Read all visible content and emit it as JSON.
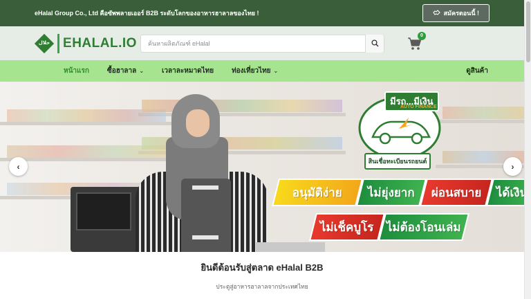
{
  "topbar": {
    "announcement": "eHalal Group Co., Ltd คือซัพพลายเออร์ B2B ระดับโลกของอาหารฮาลาลของไทย !",
    "signup_label": "สมัครตอนนี้ !",
    "signup_icon": "handshake-icon"
  },
  "header": {
    "logo_badge": "حلال",
    "logo_e": "E",
    "logo_rest": "HALAL.IO",
    "search_placeholder": "ค้นหาผลิตภัณฑ์ eHalal",
    "cart_count": "0"
  },
  "nav": {
    "items": [
      {
        "label": "หน้าแรก",
        "active": true,
        "dropdown": false
      },
      {
        "label": "ซื้อฮาลาล",
        "active": false,
        "dropdown": true
      },
      {
        "label": "เวลาละหมาดไทย",
        "active": false,
        "dropdown": false
      },
      {
        "label": "ท่องเที่ยวไทย",
        "active": false,
        "dropdown": true
      }
    ],
    "right_label": "ดูสินค้า"
  },
  "hero": {
    "badge_title": "มีรถ...มีเงิน",
    "badge_sub": "AUTO FINANCE",
    "badge_foot": "สินเชื่อทะเบียนรถยนต์",
    "ribbon_row1": [
      "อนุมัติง่าย",
      "ไม่ยุ่งยาก",
      "ผ่อนสบาย",
      "ได้เงินไว"
    ],
    "ribbon_row2": [
      "ไม่เช็คบูโร",
      "ไม่ต้องโอนเล่ม"
    ],
    "prev_icon": "chevron-left-icon",
    "next_icon": "chevron-right-icon"
  },
  "welcome": {
    "title": "ยินดีต้อนรับสู่ตลาด eHalal B2B",
    "subtitle": "ประตูสู่อาหารฮาลาลจากประเทศไทย"
  },
  "colors": {
    "topbar": "#3b5e3a",
    "header": "#e6ece6",
    "nav": "#a6e48f",
    "brand": "#2e7d32"
  }
}
